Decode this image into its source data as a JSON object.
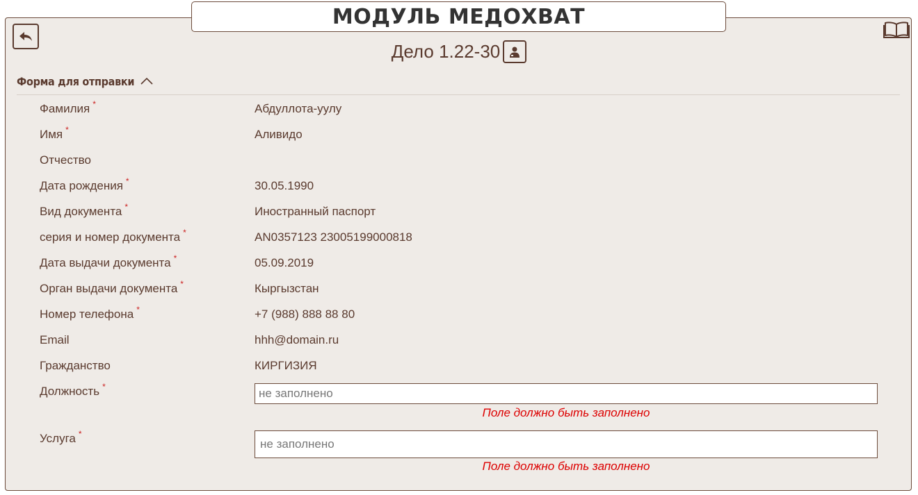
{
  "header": {
    "app_title": "МОДУЛЬ МЕДОХВАТ",
    "case_title": "Дело 1.22-30"
  },
  "icons": {
    "back": "back-arrow-icon",
    "help": "book-icon",
    "person": "person-icon",
    "chevron": "chevron-up-icon"
  },
  "section": {
    "title": "Форма для отправки"
  },
  "fields": [
    {
      "label": "Фамилия",
      "required": "*",
      "value": "Абдуллота-уулу"
    },
    {
      "label": "Имя",
      "required": "*",
      "value": "Аливидо"
    },
    {
      "label": "Отчество",
      "required": "",
      "value": ""
    },
    {
      "label": "Дата рождения",
      "required": "*",
      "value": "30.05.1990"
    },
    {
      "label": "Вид документа",
      "required": "*",
      "value": "Иностранный паспорт"
    },
    {
      "label": "серия и номер документа",
      "required": "*",
      "value": "AN0357123 23005199000818"
    },
    {
      "label": "Дата выдачи документа",
      "required": "*",
      "value": "05.09.2019"
    },
    {
      "label": "Орган выдачи документа",
      "required": "*",
      "value": "Кыргызстан"
    },
    {
      "label": "Номер телефона",
      "required": "*",
      "value": "+7 (988) 888 88 80"
    },
    {
      "label": "Email",
      "required": "",
      "value": "hhh@domain.ru"
    },
    {
      "label": "Гражданство",
      "required": "",
      "value": "КИРГИЗИЯ"
    }
  ],
  "position_field": {
    "label": "Должность",
    "required": "*",
    "placeholder": "не заполнено",
    "error": "Поле должно быть заполнено"
  },
  "service_field": {
    "label": "Услуга",
    "required": "*",
    "placeholder": "не заполнено",
    "error": "Поле должно быть заполнено"
  },
  "colors": {
    "brown": "#5a3a2e",
    "panel_bg": "#efebe7",
    "error_red": "#dd0000",
    "required_red": "#cc2222"
  }
}
